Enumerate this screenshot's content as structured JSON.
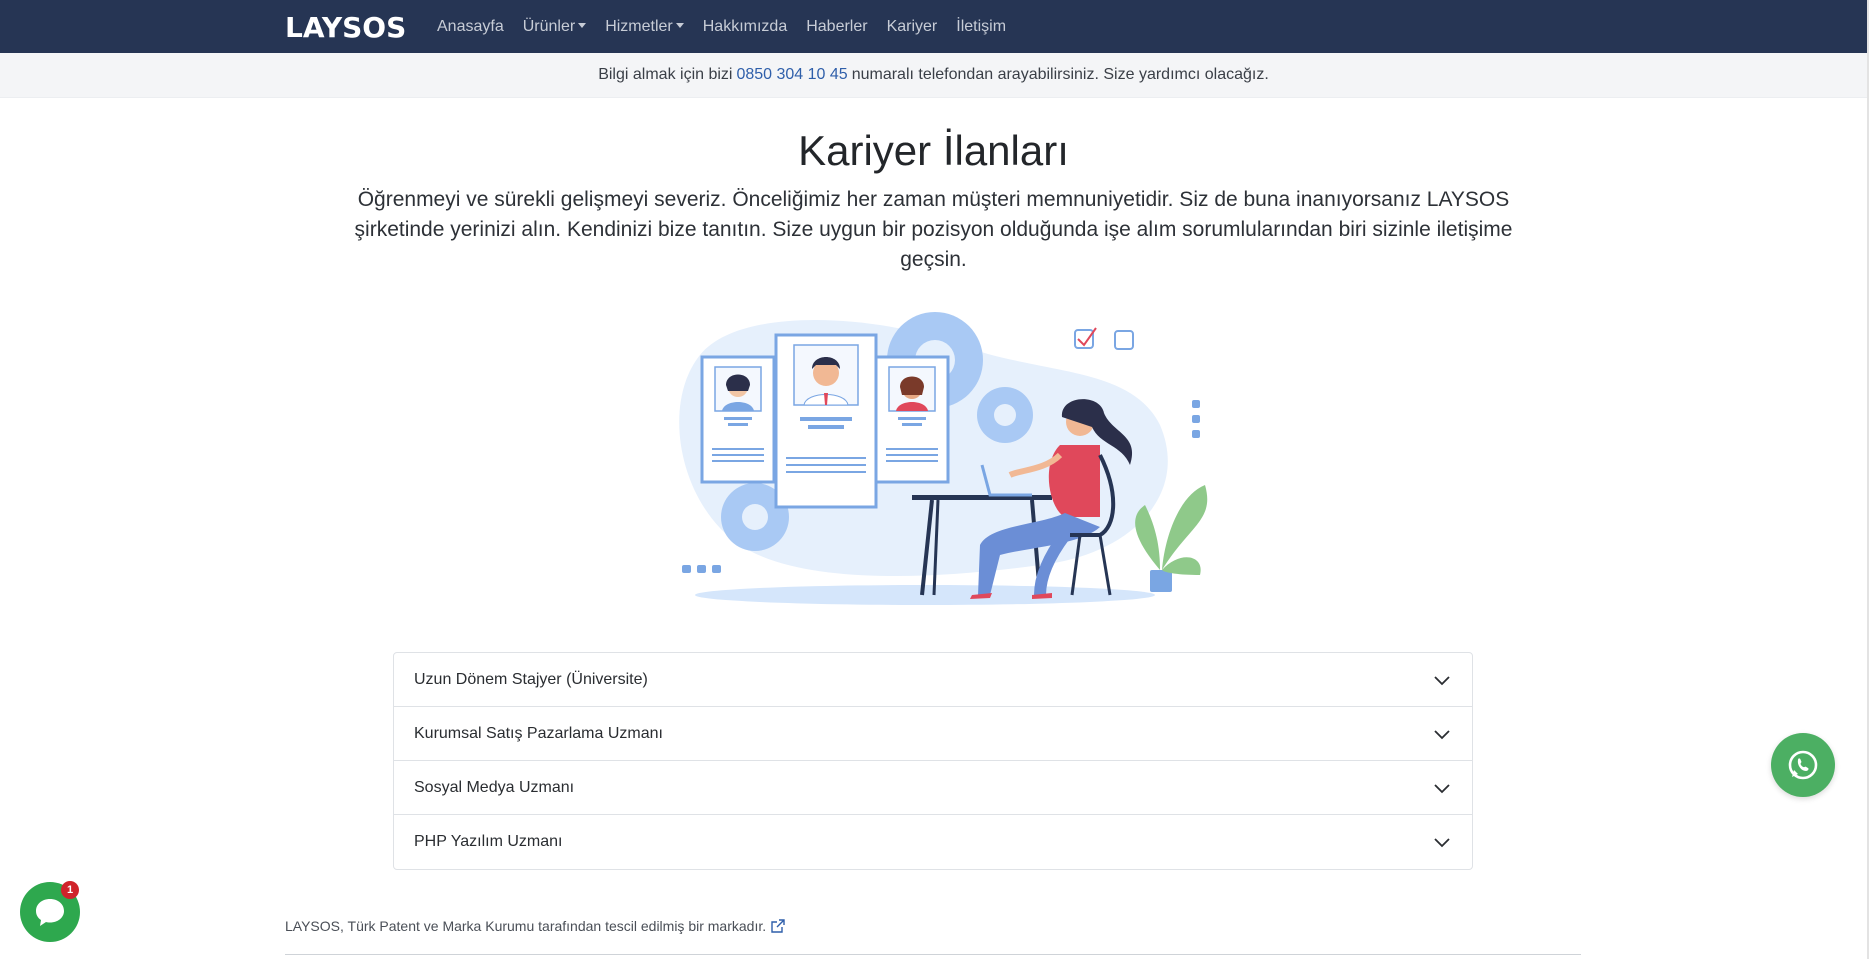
{
  "brand": "LAYSOS",
  "nav": {
    "items": [
      {
        "label": "Anasayfa",
        "dropdown": false
      },
      {
        "label": "Ürünler",
        "dropdown": true
      },
      {
        "label": "Hizmetler",
        "dropdown": true
      },
      {
        "label": "Hakkımızda",
        "dropdown": false
      },
      {
        "label": "Haberler",
        "dropdown": false
      },
      {
        "label": "Kariyer",
        "dropdown": false
      },
      {
        "label": "İletişim",
        "dropdown": false
      }
    ]
  },
  "infobar": {
    "before": "Bilgi almak için bizi",
    "phone": "0850 304 10 45",
    "after": "numaralı telefondan arayabilirsiniz. Size yardımcı olacağız."
  },
  "page": {
    "title": "Kariyer İlanları",
    "intro": "Öğrenmeyi ve sürekli gelişmeyi severiz. Önceliğimiz her zaman müşteri memnuniyetidir. Siz de buna inanıyorsanız LAYSOS şirketinde yerinizi alın. Kendinizi bize tanıtın. Size uygun bir pozisyon olduğunda işe alım sorumlularından biri sizinle iletişime geçsin."
  },
  "jobs": [
    {
      "title": "Uzun Dönem Stajyer (Üniversite)"
    },
    {
      "title": "Kurumsal Satış Pazarlama Uzmanı"
    },
    {
      "title": "Sosyal Medya Uzmanı"
    },
    {
      "title": "PHP Yazılım Uzmanı"
    }
  ],
  "footer": {
    "note": "LAYSOS, Türk Patent ve Marka Kurumu tarafından tescil edilmiş bir markadır.",
    "link_icon": "external-link-icon"
  },
  "chat": {
    "badge": "1",
    "icon": "chat-bubble-icon"
  },
  "whatsapp": {
    "icon": "whatsapp-icon"
  },
  "colors": {
    "navbar": "#263554",
    "infobar": "#f4f5f7",
    "phone_link": "#2f5faa",
    "whatsapp": "#4caf63",
    "chat": "#2ea84e",
    "badge": "#d0232a"
  }
}
